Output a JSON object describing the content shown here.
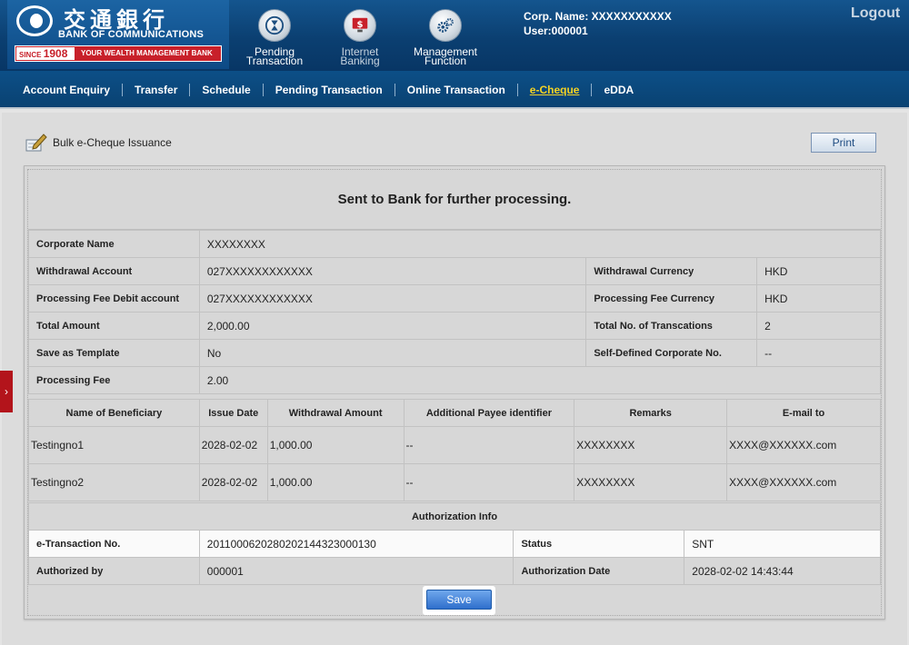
{
  "brand": {
    "name_cn": "交通銀行",
    "name_en": "BANK OF COMMUNICATIONS",
    "since_label": "SINCE",
    "since_year": "1908",
    "slogan": "YOUR WEALTH MANAGEMENT BANK"
  },
  "header_nav": [
    {
      "label_1": "Pending",
      "label_2": "Transaction",
      "icon": "hourglass-icon"
    },
    {
      "label_1": "Internet",
      "label_2": "Banking",
      "icon": "monitor-dollar-icon"
    },
    {
      "label_1": "Management",
      "label_2": "Function",
      "icon": "gears-icon"
    }
  ],
  "user": {
    "corp_name": "Corp. Name: XXXXXXXXXXX",
    "user_id": "User:000001"
  },
  "logout_label": "Logout",
  "menu": [
    "Account Enquiry",
    "Transfer",
    "Schedule",
    "Pending Transaction",
    "Online Transaction",
    "e-Cheque",
    "eDDA"
  ],
  "active_menu": "e-Cheque",
  "page": {
    "title": "Bulk e-Cheque Issuance",
    "print_label": "Print",
    "message": "Sent to Bank for further processing."
  },
  "details": {
    "corporate_name_label": "Corporate Name",
    "corporate_name": "XXXXXXXX",
    "withdrawal_account_label": "Withdrawal Account",
    "withdrawal_account": "027XXXXXXXXXXXX",
    "withdrawal_currency_label": "Withdrawal Currency",
    "withdrawal_currency": "HKD",
    "fee_account_label": "Processing Fee Debit account",
    "fee_account": "027XXXXXXXXXXXX",
    "fee_currency_label": "Processing Fee Currency",
    "fee_currency": "HKD",
    "total_amount_label": "Total Amount",
    "total_amount": "2,000.00",
    "total_txn_label": "Total No. of Transcations",
    "total_txn": "2",
    "template_label": "Save as Template",
    "template": "No",
    "self_defined_label": "Self-Defined Corporate No.",
    "self_defined": "--",
    "fee_label": "Processing Fee",
    "fee": "2.00"
  },
  "beneficiaries": {
    "headers": [
      "Name of Beneficiary",
      "Issue Date",
      "Withdrawal Amount",
      "Additional Payee identifier",
      "Remarks",
      "E-mail to"
    ],
    "rows": [
      [
        "Testingno1",
        "2028-02-02",
        "1,000.00",
        "--",
        "XXXXXXXX",
        "XXXX@XXXXXX.com"
      ],
      [
        "Testingno2",
        "2028-02-02",
        "1,000.00",
        "--",
        "XXXXXXXX",
        "XXXX@XXXXXX.com"
      ]
    ]
  },
  "authorization": {
    "header": "Authorization Info",
    "etxn_label": "e-Transaction No.",
    "etxn": "20110006202802021443230001​30",
    "status_label": "Status",
    "status": "SNT",
    "authorized_by_label": "Authorized by",
    "authorized_by": "000001",
    "auth_date_label": "Authorization Date",
    "auth_date": "2028-02-02 14:43:44"
  },
  "save_label": "Save",
  "side_tab_label": "›"
}
